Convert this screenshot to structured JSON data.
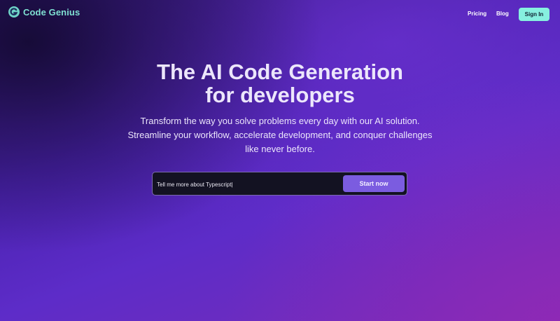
{
  "header": {
    "brand": "Code Genius",
    "logo_icon": "g-logo-icon",
    "nav": [
      {
        "label": "Pricing"
      },
      {
        "label": "Blog"
      }
    ],
    "signin_label": "Sign In"
  },
  "hero": {
    "title_line1": "The AI Code Generation",
    "title_line2": "for developers",
    "subtitle_line1": "Transform the way you solve problems every day with our AI solution.",
    "subtitle_line2": "Streamline your workflow, accelerate development, and conquer challenges",
    "subtitle_line3": "like never before."
  },
  "prompt": {
    "value": "Tell me more about Typescript|",
    "button_label": "Start now"
  },
  "colors": {
    "brand": "#7fe0d2",
    "signin_bg": "#86f0df",
    "button_bg": "#7b5ce0",
    "background": "#5b2cc4"
  }
}
